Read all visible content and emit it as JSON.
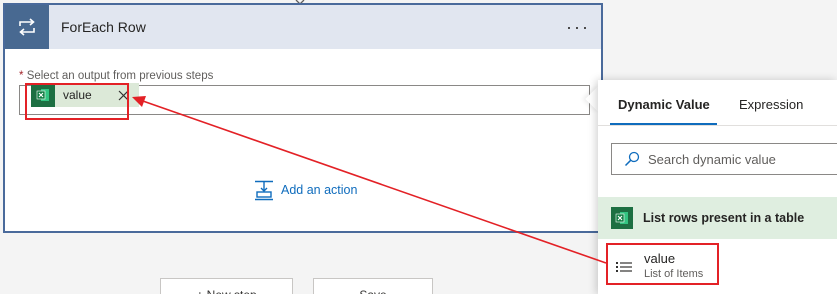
{
  "card": {
    "title": "ForEach Row",
    "menu_label": "···",
    "field": {
      "required_mark": "*",
      "label": "Select an output from previous steps"
    },
    "token": {
      "label": "value",
      "icon": "excel-icon"
    },
    "add_action_label": "Add an action"
  },
  "bottom_buttons": {
    "new_step": "+ New step",
    "save": "Save"
  },
  "dynamic_panel": {
    "tabs": [
      {
        "label": "Dynamic Value",
        "selected": true
      },
      {
        "label": "Expression",
        "selected": false
      }
    ],
    "search": {
      "placeholder": "Search dynamic value"
    },
    "section": {
      "title": "List rows present in a table",
      "icon": "excel-icon"
    },
    "items": [
      {
        "title": "value",
        "subtitle": "List of Items",
        "icon": "list-icon"
      }
    ]
  },
  "colors": {
    "card_border": "#4a6a9b",
    "card_icon_bg": "#486991",
    "excel_green": "#1d6f42",
    "link_blue": "#0f6cbd",
    "annotation_red": "#e32126"
  }
}
